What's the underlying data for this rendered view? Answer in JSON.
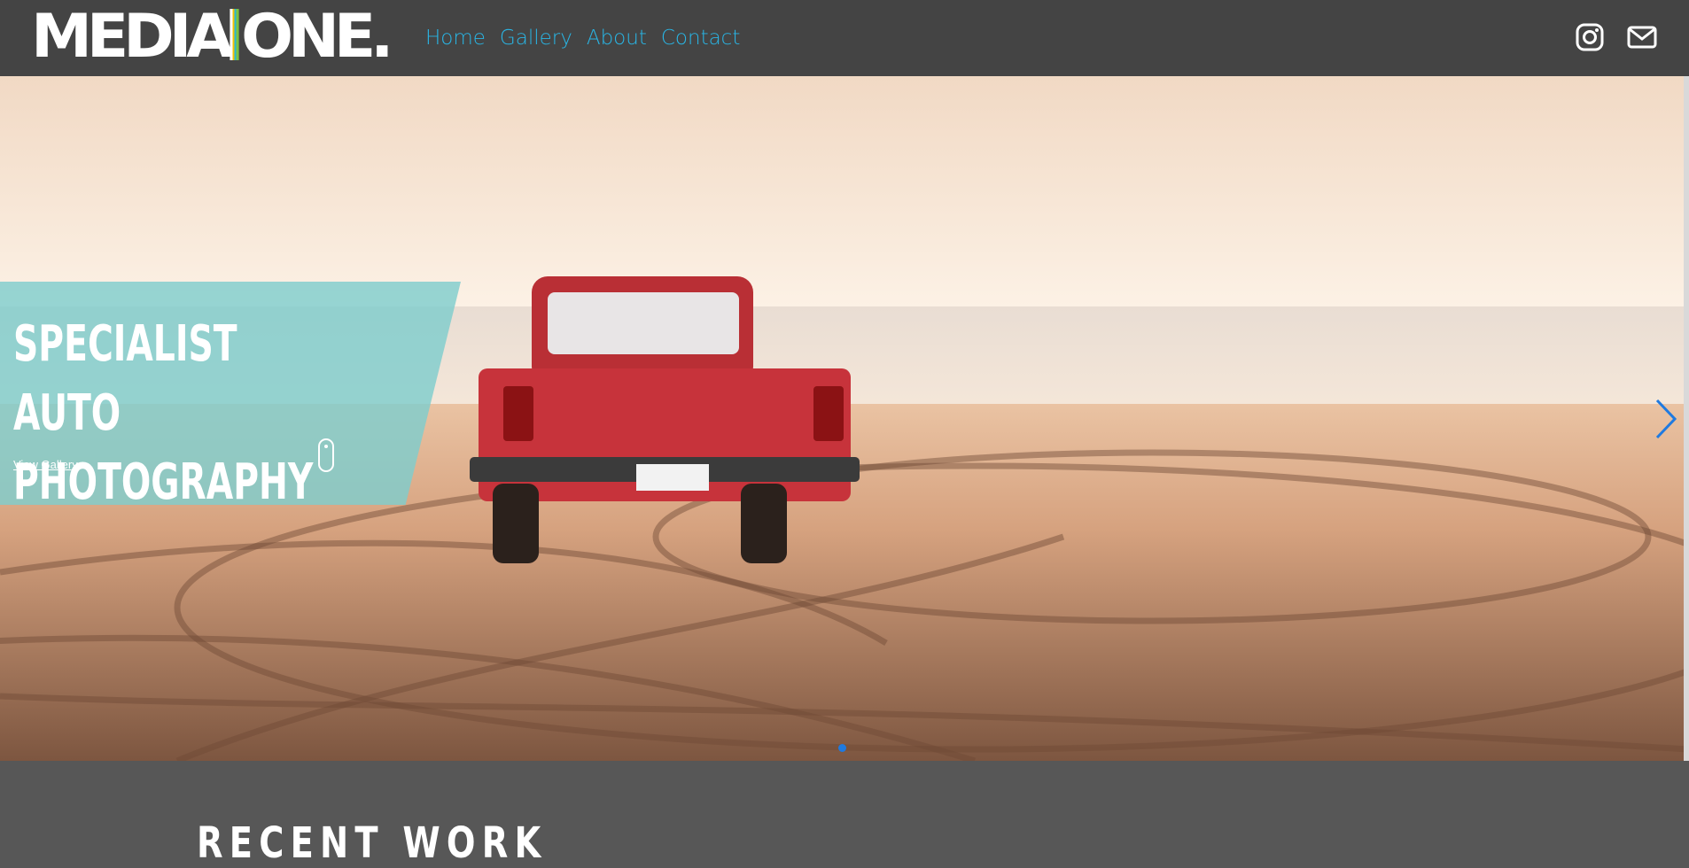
{
  "header": {
    "logo_left": "MEDIA",
    "logo_right": "ONE.",
    "nav": [
      {
        "label": "Home"
      },
      {
        "label": "Gallery"
      },
      {
        "label": "About"
      },
      {
        "label": "Contact"
      }
    ],
    "icons": [
      "instagram-icon",
      "mail-icon"
    ],
    "colors": {
      "bar": "#444444",
      "nav_link": "#29b6e6"
    }
  },
  "hero": {
    "title": "SPECIALIST AUTO PHOTOGRAPHY",
    "link_label": "View Gallery",
    "slide_count": 1,
    "active_slide": 1,
    "colors": {
      "caption_panel": "#7fcdcd",
      "active_dot": "#1f7ae0"
    }
  },
  "section": {
    "heading": "RECENT WORK"
  }
}
